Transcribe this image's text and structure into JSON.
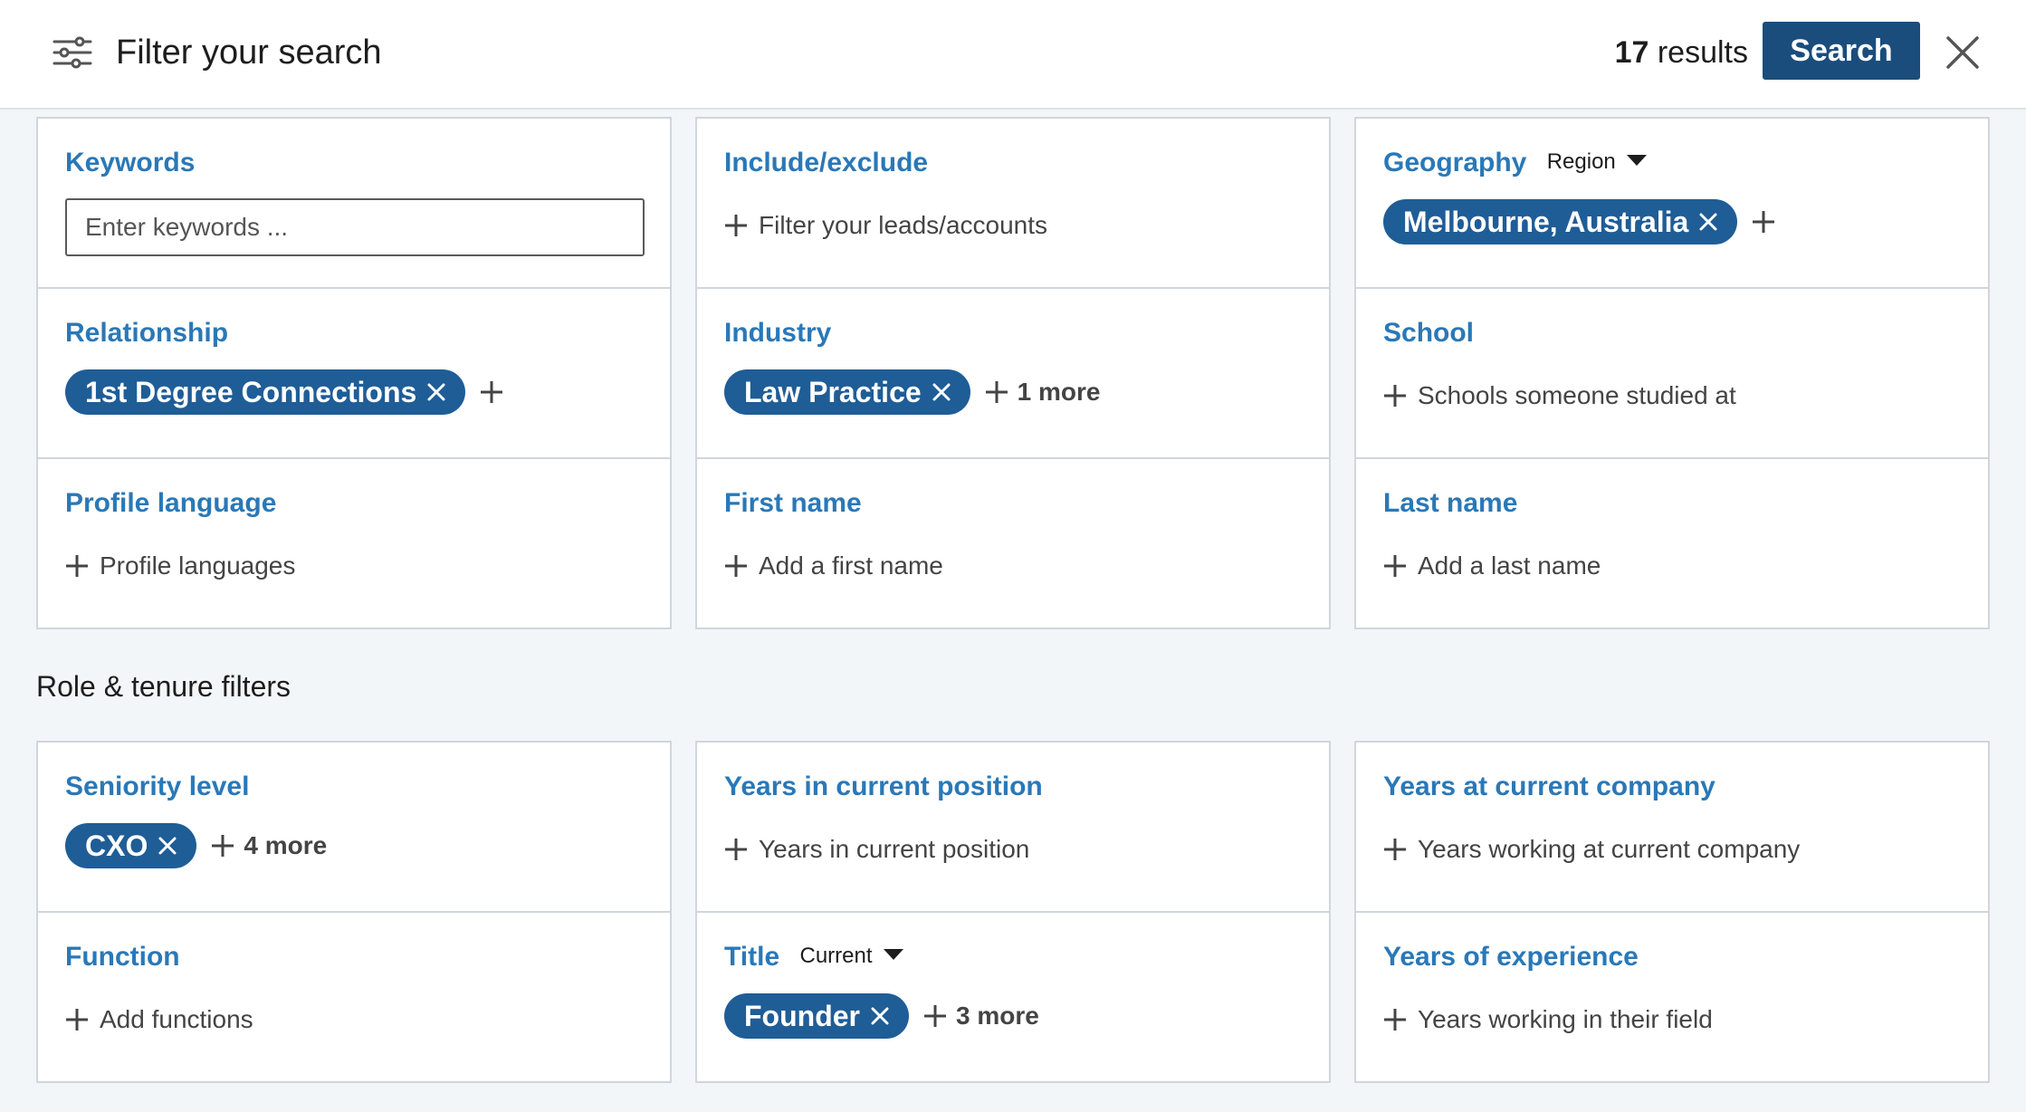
{
  "header": {
    "title": "Filter your search",
    "results_count": "17",
    "results_label": "results",
    "search_label": "Search"
  },
  "filters": {
    "keywords": {
      "title": "Keywords",
      "placeholder": "Enter keywords ..."
    },
    "include_exclude": {
      "title": "Include/exclude",
      "add_text": "Filter your leads/accounts"
    },
    "geography": {
      "title": "Geography",
      "subselect": "Region",
      "selected": "Melbourne, Australia"
    },
    "relationship": {
      "title": "Relationship",
      "selected": "1st Degree Connections"
    },
    "industry": {
      "title": "Industry",
      "selected": "Law Practice",
      "more": "1 more"
    },
    "school": {
      "title": "School",
      "add_text": "Schools someone studied at"
    },
    "profile_language": {
      "title": "Profile language",
      "add_text": "Profile languages"
    },
    "first_name": {
      "title": "First name",
      "add_text": "Add a first name"
    },
    "last_name": {
      "title": "Last name",
      "add_text": "Add a last name"
    }
  },
  "role_section": {
    "heading": "Role & tenure filters",
    "seniority": {
      "title": "Seniority level",
      "selected": "CXO",
      "more": "4 more"
    },
    "years_position": {
      "title": "Years in current position",
      "add_text": "Years in current position"
    },
    "years_company": {
      "title": "Years at current company",
      "add_text": "Years working at current company"
    },
    "function": {
      "title": "Function",
      "add_text": "Add functions"
    },
    "title": {
      "title": "Title",
      "subselect": "Current",
      "selected": "Founder",
      "more": "3 more"
    },
    "years_experience": {
      "title": "Years of experience",
      "add_text": "Years working in their field"
    }
  },
  "colors": {
    "accent": "#2a78b7",
    "pill": "#1f5d97",
    "button": "#1a4d7c",
    "background": "#f3f6f8"
  },
  "icons": [
    "sliders-icon",
    "close-icon",
    "plus-icon",
    "remove-x-icon",
    "caret-down-icon"
  ]
}
